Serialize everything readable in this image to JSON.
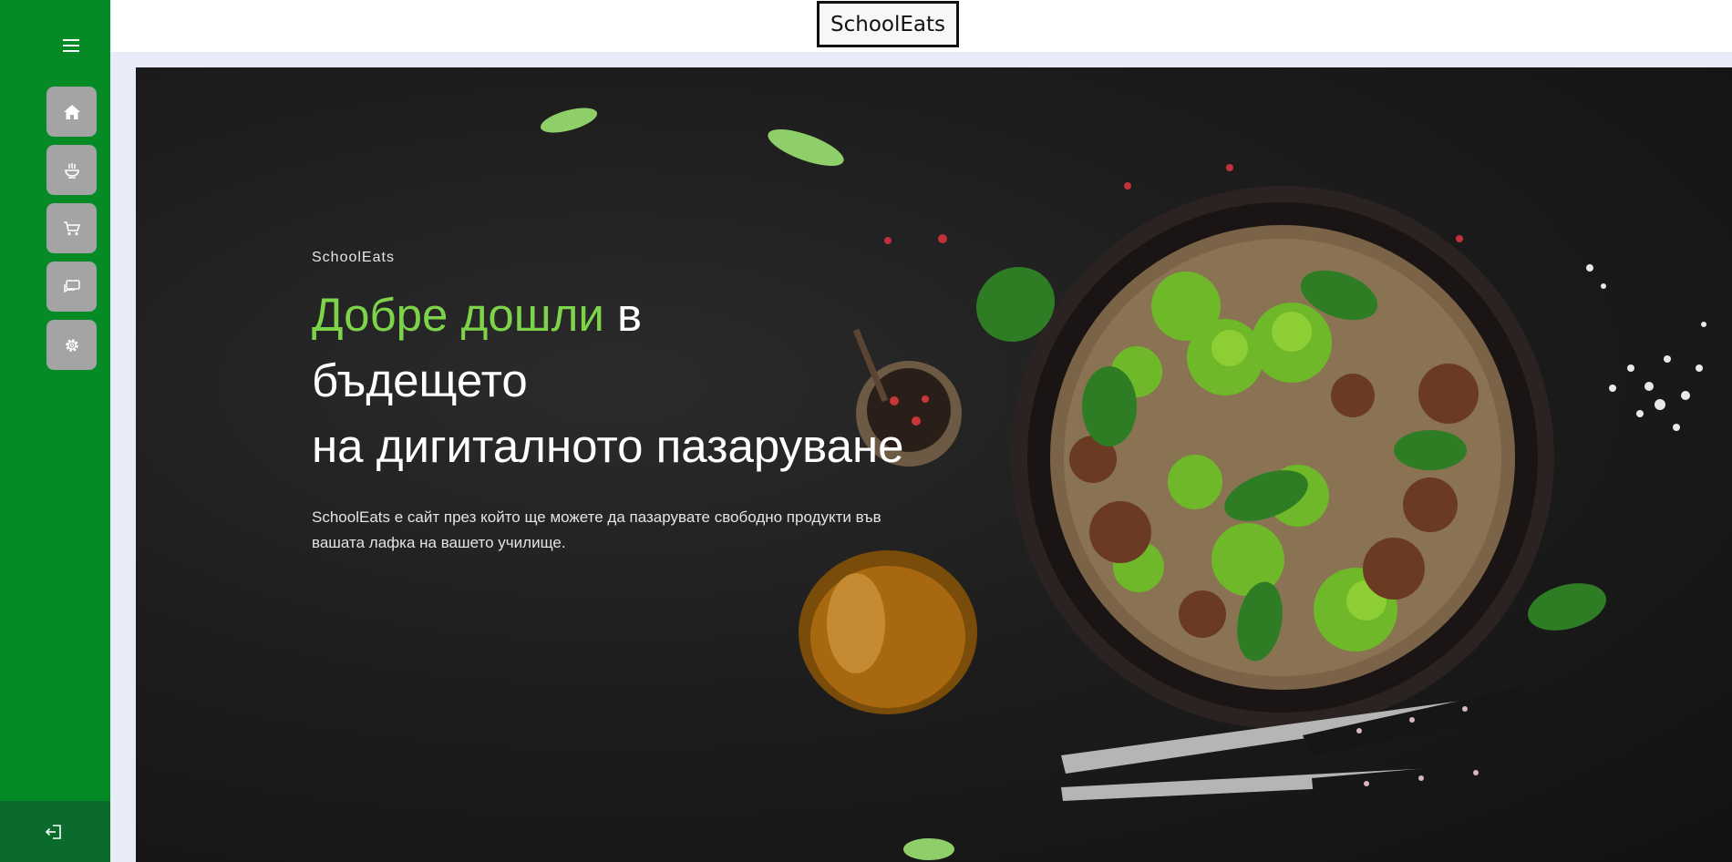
{
  "header": {
    "brand": "SchoolEats"
  },
  "sidebar": {
    "menu_icon": "hamburger-icon",
    "items": [
      {
        "id": "home",
        "icon": "home-icon"
      },
      {
        "id": "food",
        "icon": "food-bowl-icon"
      },
      {
        "id": "cart",
        "icon": "cart-icon"
      },
      {
        "id": "messages",
        "icon": "chat-icon"
      },
      {
        "id": "settings",
        "icon": "gear-icon"
      }
    ],
    "logout_icon": "logout-icon"
  },
  "hero": {
    "eyebrow": "SchoolEats",
    "headline_accent": "Добре дошли",
    "headline_rest1": " в",
    "headline_line2": "бъдещето",
    "headline_line3": "на дигиталното пазаруване",
    "description": "SchoolEats е сайт през който ще можете да пазарувате свободно продукти във вашата лафка на вашето училище."
  },
  "colors": {
    "sidebar": "#048b26",
    "logout": "#0a6b2c",
    "nav_button": "#a4a4a4",
    "accent": "#7dd44a",
    "hero_bg": "#1d1d1d"
  }
}
